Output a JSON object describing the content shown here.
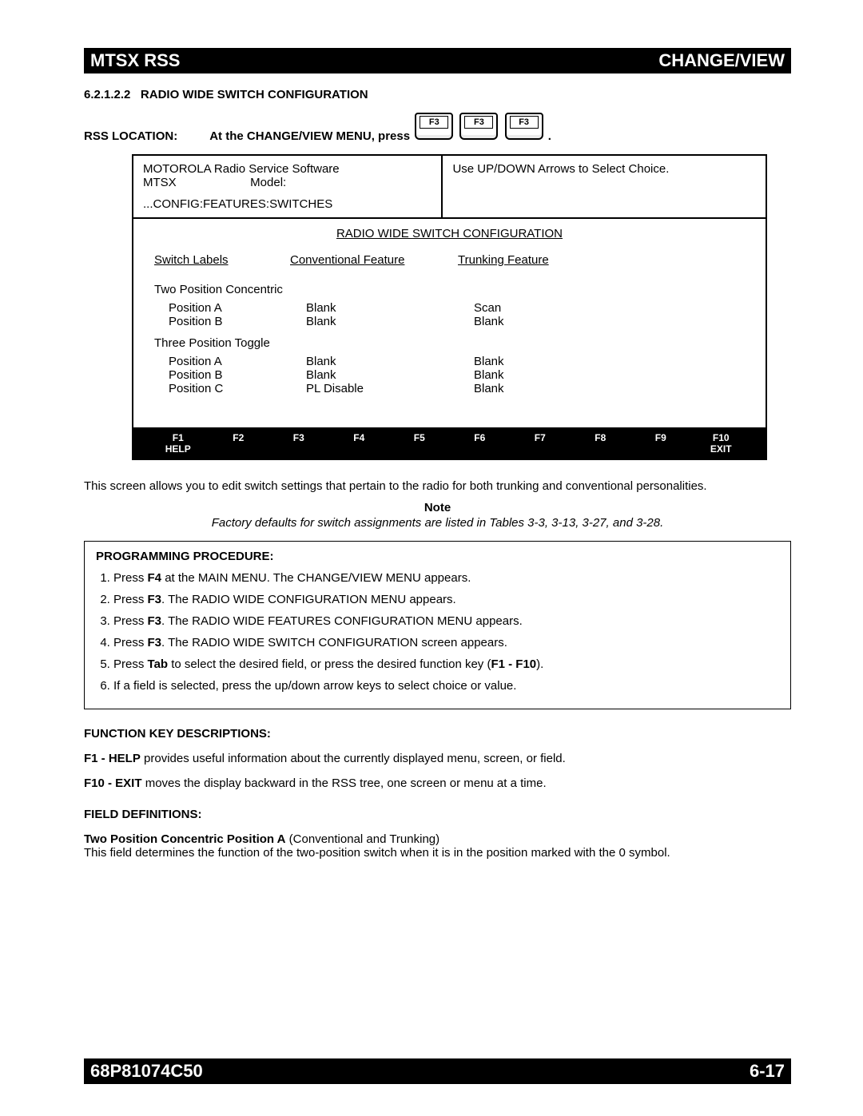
{
  "header": {
    "left": "MTSX RSS",
    "right": "CHANGE/VIEW"
  },
  "footer": {
    "left": "68P81074C50",
    "right": "6-17"
  },
  "section": {
    "number": "6.2.1.2.2",
    "title": "RADIO WIDE SWITCH CONFIGURATION"
  },
  "rss_location": {
    "label": "RSS LOCATION:",
    "text": "At the CHANGE/VIEW MENU, press",
    "keys": [
      "F3",
      "F3",
      "F3"
    ],
    "period": "."
  },
  "screen": {
    "top_left_line1": "MOTOROLA Radio Service Software",
    "top_left_line2a": "MTSX",
    "top_left_line2b": "Model:",
    "top_left_line3": "...CONFIG:FEATURES:SWITCHES",
    "top_right": "Use UP/DOWN Arrows to Select Choice.",
    "main_title": "RADIO WIDE SWITCH CONFIGURATION",
    "col_heads": {
      "switch_labels": "Switch Labels",
      "conventional": "Conventional Feature",
      "trunking": "Trunking Feature"
    },
    "group1": {
      "title": "Two Position Concentric",
      "rows": [
        {
          "label": "Position A",
          "conv": "Blank",
          "trunk": "Scan"
        },
        {
          "label": "Position B",
          "conv": "Blank",
          "trunk": "Blank"
        }
      ]
    },
    "group2": {
      "title": "Three Position Toggle",
      "rows": [
        {
          "label": "Position A",
          "conv": "Blank",
          "trunk": "Blank"
        },
        {
          "label": "Position B",
          "conv": "Blank",
          "trunk": "Blank"
        },
        {
          "label": "Position C",
          "conv": "PL Disable",
          "trunk": "Blank"
        }
      ]
    },
    "fkeys": [
      {
        "top": "F1",
        "bottom": "HELP"
      },
      {
        "top": "F2",
        "bottom": ""
      },
      {
        "top": "F3",
        "bottom": ""
      },
      {
        "top": "F4",
        "bottom": ""
      },
      {
        "top": "F5",
        "bottom": ""
      },
      {
        "top": "F6",
        "bottom": ""
      },
      {
        "top": "F7",
        "bottom": ""
      },
      {
        "top": "F8",
        "bottom": ""
      },
      {
        "top": "F9",
        "bottom": ""
      },
      {
        "top": "F10",
        "bottom": "EXIT"
      }
    ]
  },
  "body_para": "This screen allows you to edit switch settings that pertain to the radio for both trunking and conventional personalities.",
  "note": {
    "head": "Note",
    "text": "Factory defaults for switch assignments are listed in Tables 3-3, 3-13, 3-27, and 3-28."
  },
  "proc_head": "PROGRAMMING PROCEDURE:",
  "proc_steps": [
    {
      "pre": "Press ",
      "key": "F4",
      "post": " at the MAIN MENU. The CHANGE/VIEW MENU appears."
    },
    {
      "pre": "Press ",
      "key": "F3",
      "post": ". The RADIO WIDE CONFIGURATION MENU appears."
    },
    {
      "pre": "Press ",
      "key": "F3",
      "post": ". The RADIO WIDE FEATURES CONFIGURATION MENU appears."
    },
    {
      "pre": "Press ",
      "key": "F3",
      "post": ". The RADIO WIDE SWITCH CONFIGURATION screen appears."
    },
    {
      "pre": "Press ",
      "key": "Tab",
      "post": " to select the desired field, or press the desired function key (",
      "key2": "F1 - F10",
      "post2": ")."
    },
    {
      "pre": "If a field is selected, press the up/down arrow keys to select choice or value.",
      "key": "",
      "post": ""
    }
  ],
  "fn_head": "FUNCTION KEY DESCRIPTIONS:",
  "fn_descs": [
    {
      "key": "F1 - HELP",
      "text": " provides useful information about the currently displayed menu, screen, or field."
    },
    {
      "key": "F10 - EXIT",
      "text": " moves the display backward in the RSS tree, one screen or menu at a time."
    }
  ],
  "field_head": "FIELD DEFINITIONS:",
  "field_def": {
    "title": "Two Position Concentric Position A",
    "suffix": " (Conventional and Trunking)",
    "body": "This field determines the function of the two-position switch when it is in the position marked with the 0  symbol."
  }
}
